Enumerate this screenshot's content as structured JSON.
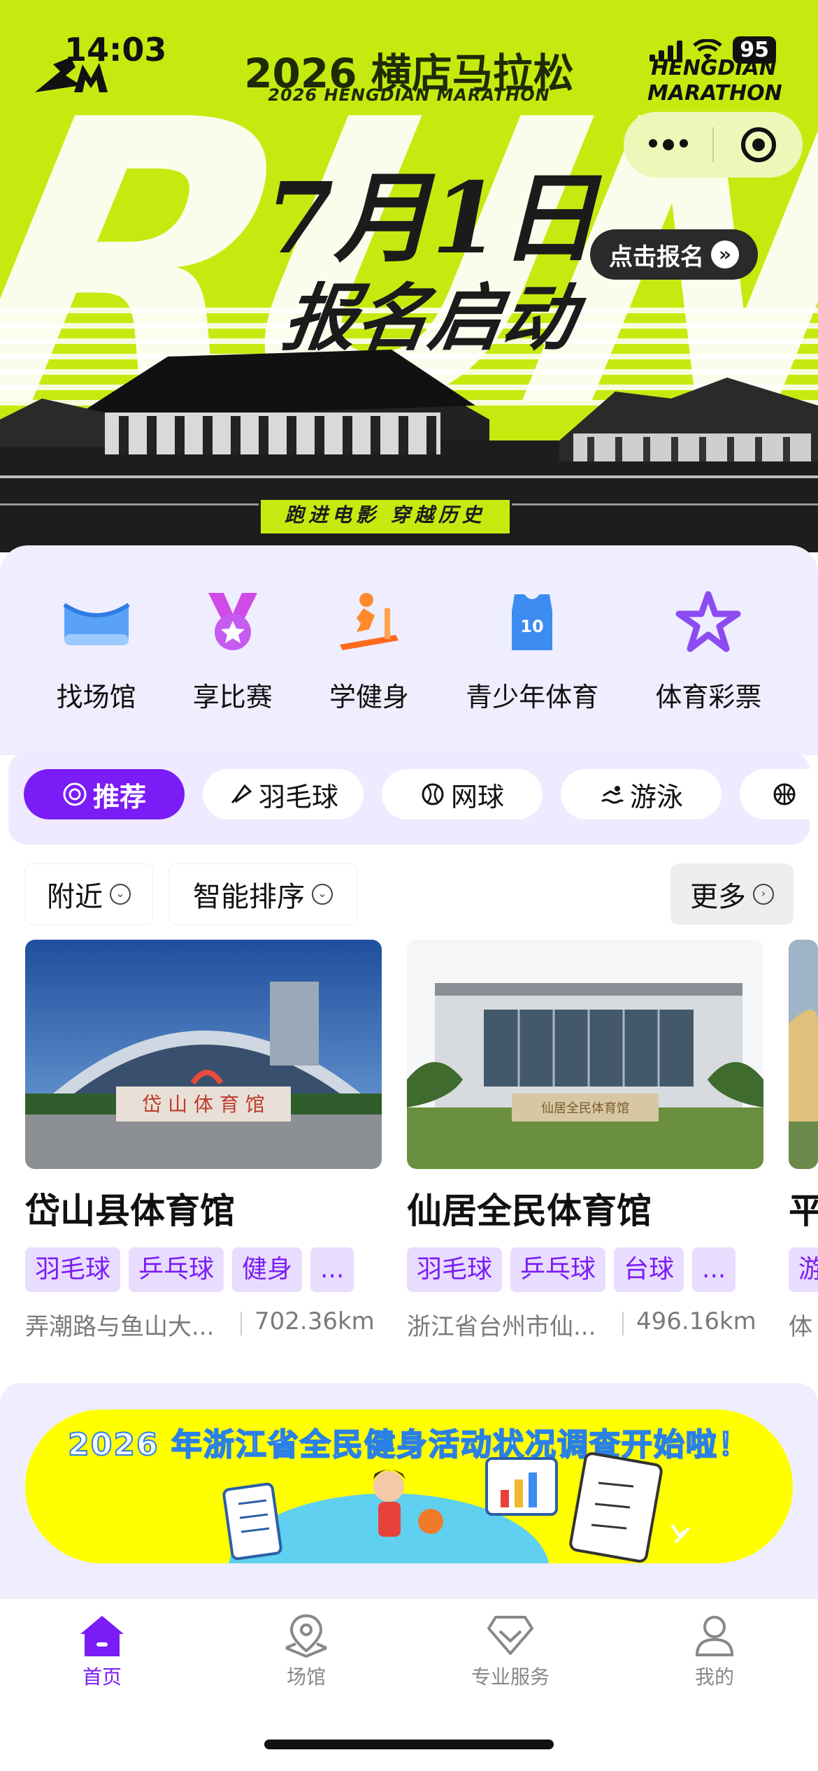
{
  "status_bar": {
    "time": "14:03",
    "battery": "95"
  },
  "banner": {
    "title": "2026 横店马拉松",
    "subtitle": "2026 HENGDIAN MARATHON",
    "logo_right": "HENGDIAN MARATHON",
    "big_text": "RUN",
    "date": "7月1日",
    "slogan": "报名启动",
    "signup_button": "点击报名",
    "tagline": "跑进电影 穿越历史",
    "accent_color": "#c6ea0f"
  },
  "quick_nav": [
    {
      "label": "找场馆",
      "icon": "stadium-icon"
    },
    {
      "label": "享比赛",
      "icon": "medal-icon"
    },
    {
      "label": "学健身",
      "icon": "treadmill-icon"
    },
    {
      "label": "青少年体育",
      "icon": "jersey-icon"
    },
    {
      "label": "体育彩票",
      "icon": "star-icon"
    }
  ],
  "tabs": [
    {
      "label": "推荐",
      "icon": "target-icon",
      "active": true
    },
    {
      "label": "羽毛球",
      "icon": "shuttlecock-icon"
    },
    {
      "label": "网球",
      "icon": "tennis-ball-icon"
    },
    {
      "label": "游泳",
      "icon": "swimmer-icon"
    },
    {
      "label": "",
      "icon": "basketball-icon"
    }
  ],
  "filters": {
    "nearby": "附近",
    "sort": "智能排序",
    "more": "更多"
  },
  "venues": [
    {
      "name": "岱山县体育馆",
      "tags": [
        "羽毛球",
        "乒乓球",
        "健身",
        "..."
      ],
      "address": "弄潮路与鱼山大...",
      "distance": "702.36km",
      "sign_text": "岱 山 体 育 馆"
    },
    {
      "name": "仙居全民体育馆",
      "tags": [
        "羽毛球",
        "乒乓球",
        "台球",
        "..."
      ],
      "address": "浙江省台州市仙...",
      "distance": "496.16km",
      "sign_text": "仙居全民体育馆"
    },
    {
      "name": "平",
      "tags": [
        "游"
      ],
      "address": "体",
      "distance": ""
    }
  ],
  "survey_banner": {
    "title": "2026 年浙江省全民健身活动状况调查开始啦！"
  },
  "bottom_nav": [
    {
      "label": "首页",
      "icon": "home-icon",
      "active": true
    },
    {
      "label": "场馆",
      "icon": "map-pin-icon"
    },
    {
      "label": "专业服务",
      "icon": "diamond-icon"
    },
    {
      "label": "我的",
      "icon": "user-icon"
    }
  ],
  "colors": {
    "primary": "#7a1cf5",
    "tag_bg": "#e9ddff",
    "section_bg": "#eeeeff"
  }
}
